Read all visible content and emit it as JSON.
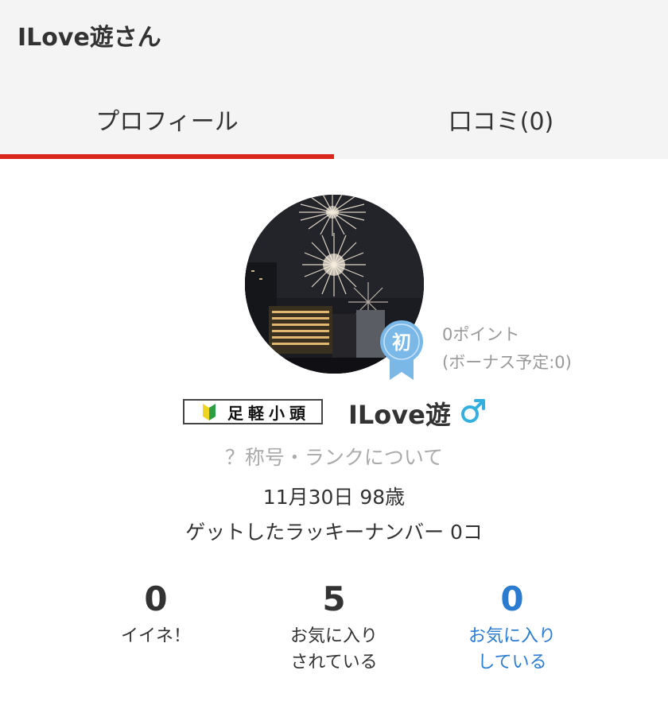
{
  "header": {
    "title": "ILove遊さん"
  },
  "tabs": [
    {
      "label": "プロフィール",
      "active": true
    },
    {
      "label": "口コミ(0)",
      "active": false
    }
  ],
  "profile": {
    "badge_char": "初",
    "points": "0ポイント",
    "bonus": "(ボーナス予定:0)",
    "rank_title": "足軽小頭",
    "name": "ILove遊",
    "gender_icon": "male-symbol-icon",
    "rank_help": "？称号・ランクについて",
    "birthday": "11月30日 98歳",
    "lucky_number": "ゲットしたラッキーナンバー 0コ"
  },
  "stats": {
    "likes": {
      "value": "0",
      "label": "イイネ！"
    },
    "favorited": {
      "value": "5",
      "label_line1": "お気に入り",
      "label_line2": "されている"
    },
    "favoriting": {
      "value": "0",
      "label_line1": "お気に入り",
      "label_line2": "している"
    }
  },
  "colors": {
    "accent": "#d9261c",
    "link": "#2b7bd1",
    "badge": "#7ab8e8",
    "gender": "#33b0e0"
  }
}
